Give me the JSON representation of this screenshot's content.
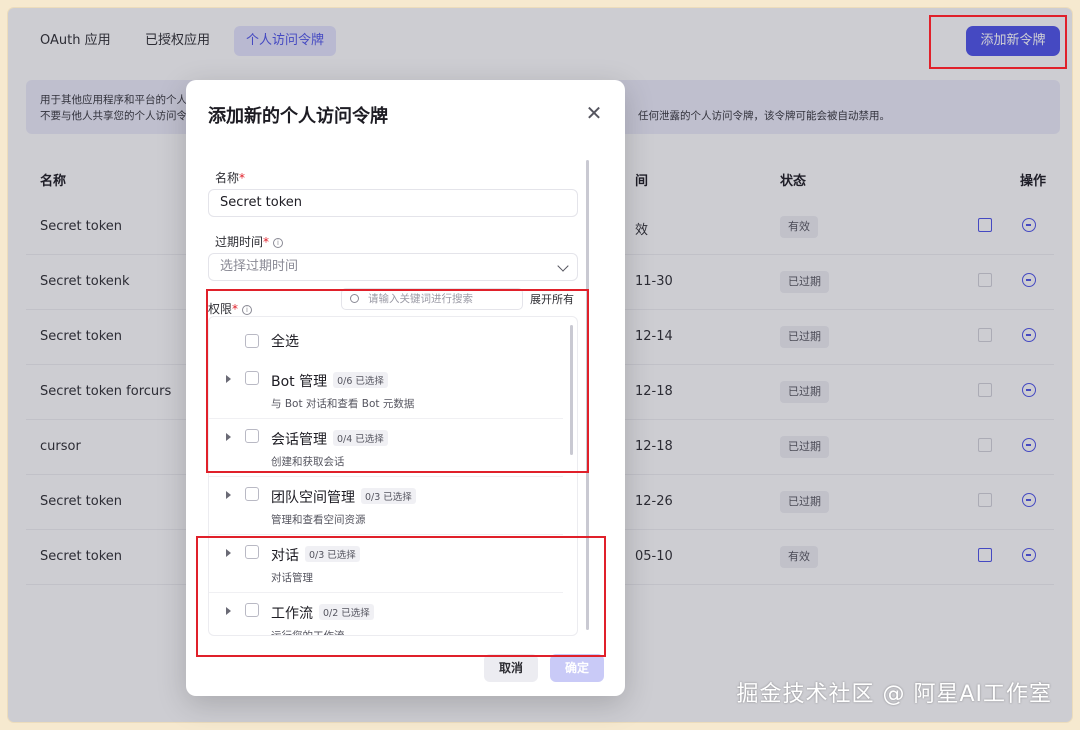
{
  "tabs": [
    {
      "label": "OAuth 应用"
    },
    {
      "label": "已授权应用"
    },
    {
      "label": "个人访问令牌"
    }
  ],
  "add_button": "添加新令牌",
  "notice": {
    "line1": "用于其他应用程序和平台的个人",
    "line2": "不要与他人共享您的个人访问令",
    "line2_tail": "任何泄露的个人访问令牌，该令牌可能会被自动禁用。"
  },
  "table": {
    "headers": {
      "name": "名称",
      "time": "间",
      "status": "状态",
      "ops": "操作"
    },
    "rows": [
      {
        "name": "Secret token",
        "time": "效",
        "status": "有效",
        "editable": true
      },
      {
        "name": "Secret tokenk",
        "time": "11-30",
        "status": "已过期",
        "editable": false
      },
      {
        "name": "Secret token",
        "time": "12-14",
        "status": "已过期",
        "editable": false
      },
      {
        "name": "Secret token forcurs",
        "time": "12-18",
        "status": "已过期",
        "editable": false
      },
      {
        "name": "cursor",
        "time": "12-18",
        "status": "已过期",
        "editable": false
      },
      {
        "name": "Secret token",
        "time": "12-26",
        "status": "已过期",
        "editable": false
      },
      {
        "name": "Secret token",
        "time": "05-10",
        "status": "有效",
        "editable": true
      }
    ]
  },
  "modal": {
    "title": "添加新的个人访问令牌",
    "name_label": "名称",
    "name_value": "Secret token",
    "expiry_label": "过期时间",
    "expiry_placeholder": "选择过期时间",
    "perm_label": "权限",
    "search_placeholder": "请输入关键词进行搜索",
    "expand_all": "展开所有",
    "select_all": "全选",
    "permissions": [
      {
        "name": "Bot 管理",
        "count": "0/6 已选择",
        "desc": "与 Bot 对话和查看 Bot 元数据"
      },
      {
        "name": "会话管理",
        "count": "0/4 已选择",
        "desc": "创建和获取会话"
      },
      {
        "name": "团队空间管理",
        "count": "0/3 已选择",
        "desc": "管理和查看空间资源"
      },
      {
        "name": "对话",
        "count": "0/3 已选择",
        "desc": "对话管理"
      },
      {
        "name": "工作流",
        "count": "0/2 已选择",
        "desc": "运行您的工作流"
      }
    ],
    "cancel": "取消",
    "confirm": "确定"
  },
  "watermark": "掘金技术社区 @ 阿星AI工作室",
  "colors": {
    "accent": "#4d53e8",
    "highlight": "#e0202a"
  }
}
